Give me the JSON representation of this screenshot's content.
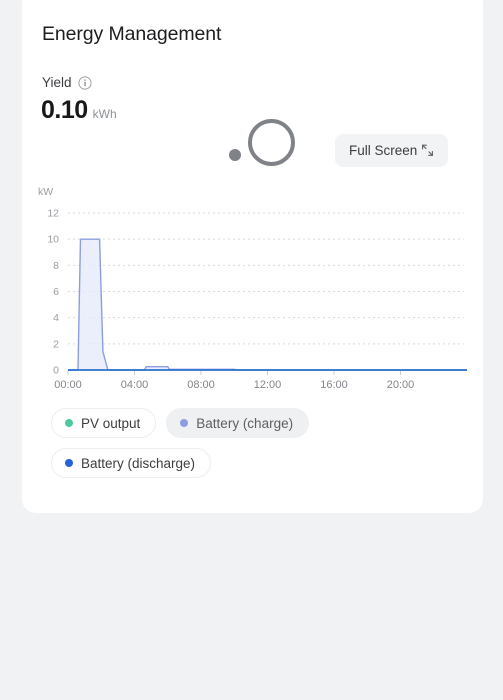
{
  "page": {
    "background_color": "#f1f2f4",
    "card_background": "#ffffff"
  },
  "card": {
    "title": "Energy Management"
  },
  "yield": {
    "label": "Yield",
    "info_icon": "info-circle-icon",
    "value": "0.10",
    "unit": "kWh"
  },
  "spinner": {
    "name": "loading-spinner",
    "color": "#7f8287"
  },
  "fullscreen": {
    "label": "Full Screen",
    "icon": "expand-diagonal-icon",
    "background": "#f2f3f5"
  },
  "legend": {
    "items": [
      {
        "label": "PV output",
        "color": "#4ecb9c",
        "active": true
      },
      {
        "label": "Battery (charge)",
        "color": "#8c9ee0",
        "active": false
      },
      {
        "label": "Battery (discharge)",
        "color": "#2563d9",
        "active": true
      }
    ]
  },
  "chart_data": {
    "type": "area",
    "title": "",
    "xlabel": "",
    "ylabel": "kW",
    "unit_label": "kW",
    "ylim": [
      0,
      12
    ],
    "yticks": [
      0,
      2,
      4,
      6,
      8,
      10,
      12
    ],
    "ytick_labels": [
      "0",
      "2",
      "4",
      "6",
      "8",
      "10",
      "12"
    ],
    "xlim": [
      0,
      24
    ],
    "xticks": [
      0,
      4,
      8,
      12,
      16,
      20
    ],
    "xtick_labels": [
      "00:00",
      "04:00",
      "08:00",
      "12:00",
      "16:00",
      "20:00"
    ],
    "grid": "horizontal-dotted",
    "legend_position": "below",
    "series": [
      {
        "name": "Battery (charge)",
        "color": "#8c9ee0",
        "fill": "#e4e9f9",
        "x": [
          0,
          0.6,
          0.75,
          1.9,
          2.1,
          2.4,
          4.6,
          4.7,
          6.0,
          6.1,
          10.0,
          10.2,
          24
        ],
        "values": [
          0,
          0,
          10.0,
          10.0,
          1.4,
          0,
          0,
          0.25,
          0.25,
          0.05,
          0.05,
          0,
          0
        ]
      },
      {
        "name": "PV output",
        "color": "#4ecb9c",
        "x": [
          0,
          24
        ],
        "values": [
          0,
          0
        ]
      },
      {
        "name": "Battery (discharge)",
        "color": "#2563d9",
        "x": [
          0,
          24
        ],
        "values": [
          0,
          0
        ]
      }
    ],
    "peak": {
      "value": 10.0,
      "time": "00:45"
    }
  }
}
